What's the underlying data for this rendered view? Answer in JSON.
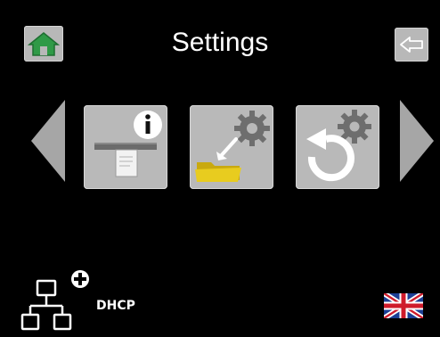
{
  "header": {
    "title": "Settings",
    "home_icon": "home-icon",
    "back_icon": "back-arrow-icon"
  },
  "carousel": {
    "prev_icon": "chevron-left-icon",
    "next_icon": "chevron-right-icon",
    "tiles": [
      {
        "icon": "device-info-icon"
      },
      {
        "icon": "folder-settings-icon"
      },
      {
        "icon": "reset-settings-icon"
      }
    ]
  },
  "footer": {
    "network_icon": "network-add-icon",
    "network_label": "DHCP",
    "language_icon": "uk-flag-icon"
  },
  "colors": {
    "background": "#000000",
    "tile": "#b9b9b9",
    "arrow": "#a6a6a6",
    "home_green": "#2f9a47",
    "folder_yellow": "#e8cc1f"
  }
}
